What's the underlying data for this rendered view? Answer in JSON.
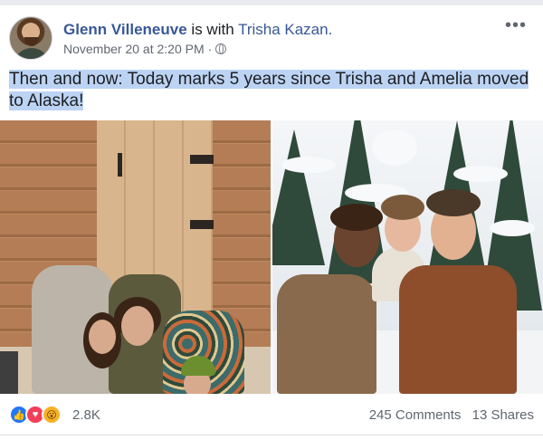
{
  "post": {
    "author_name": "Glenn Villeneuve",
    "with_text": " is with ",
    "tagged_name": "Trisha Kazan.",
    "timestamp": "November 20 at 2:20 PM",
    "separator": " · ",
    "privacy_icon": "globe-icon",
    "more_icon": "more-options-icon",
    "more_glyph": "•••",
    "text": "Then and now: Today marks 5 years since Trisha and Amelia moved to Alaska!"
  },
  "photos": [
    {
      "name": "family-cabin-photo",
      "scene": "log-cabin"
    },
    {
      "name": "family-snow-forest-photo",
      "scene": "snowy-forest"
    }
  ],
  "engagement": {
    "reaction_icons": [
      "like-icon",
      "love-icon",
      "wow-icon"
    ],
    "reaction_glyphs": [
      "👍",
      "♥",
      "😮"
    ],
    "reactions_count": "2.8K",
    "comments": "245 Comments",
    "shares": "13 Shares"
  },
  "colors": {
    "link_blue": "#385898",
    "highlight": "#bcd3f3",
    "like": "#2078f4",
    "love": "#f33e58",
    "wow": "#f7b125"
  }
}
